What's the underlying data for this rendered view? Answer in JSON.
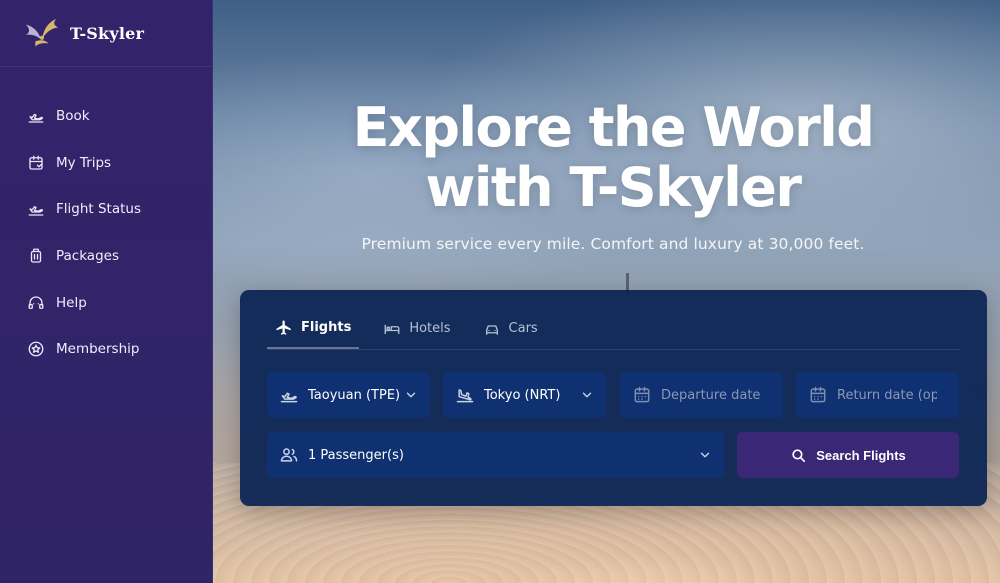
{
  "brand": {
    "name": "T-Skyler",
    "logo_icon": "winged-logo-icon"
  },
  "sidebar": {
    "items": [
      {
        "label": "Book",
        "icon": "plane-departure-icon"
      },
      {
        "label": "My Trips",
        "icon": "calendar-icon"
      },
      {
        "label": "Flight Status",
        "icon": "plane-status-icon"
      },
      {
        "label": "Packages",
        "icon": "luggage-icon"
      },
      {
        "label": "Help",
        "icon": "headset-icon"
      },
      {
        "label": "Membership",
        "icon": "star-circle-icon"
      }
    ]
  },
  "hero": {
    "title_line1": "Explore the World",
    "title_line2": "with T-Skyler",
    "subtitle": "Premium service every mile. Comfort and luxury at 30,000 feet."
  },
  "booking": {
    "tabs": [
      {
        "label": "Flights",
        "icon": "plane-icon",
        "active": true
      },
      {
        "label": "Hotels",
        "icon": "bed-icon",
        "active": false
      },
      {
        "label": "Cars",
        "icon": "car-icon",
        "active": false
      }
    ],
    "from": "Taoyuan (TPE)",
    "to": "Tokyo (NRT)",
    "departure_placeholder": "Departure date",
    "return_placeholder": "Return date (optional)",
    "passengers": "1 Passenger(s)",
    "search_label": "Search Flights"
  },
  "colors": {
    "sidebar_bg": "#33236b",
    "panel_bg": "#0b2454",
    "field_bg": "#0f3172",
    "button_bg": "#3a2775"
  }
}
